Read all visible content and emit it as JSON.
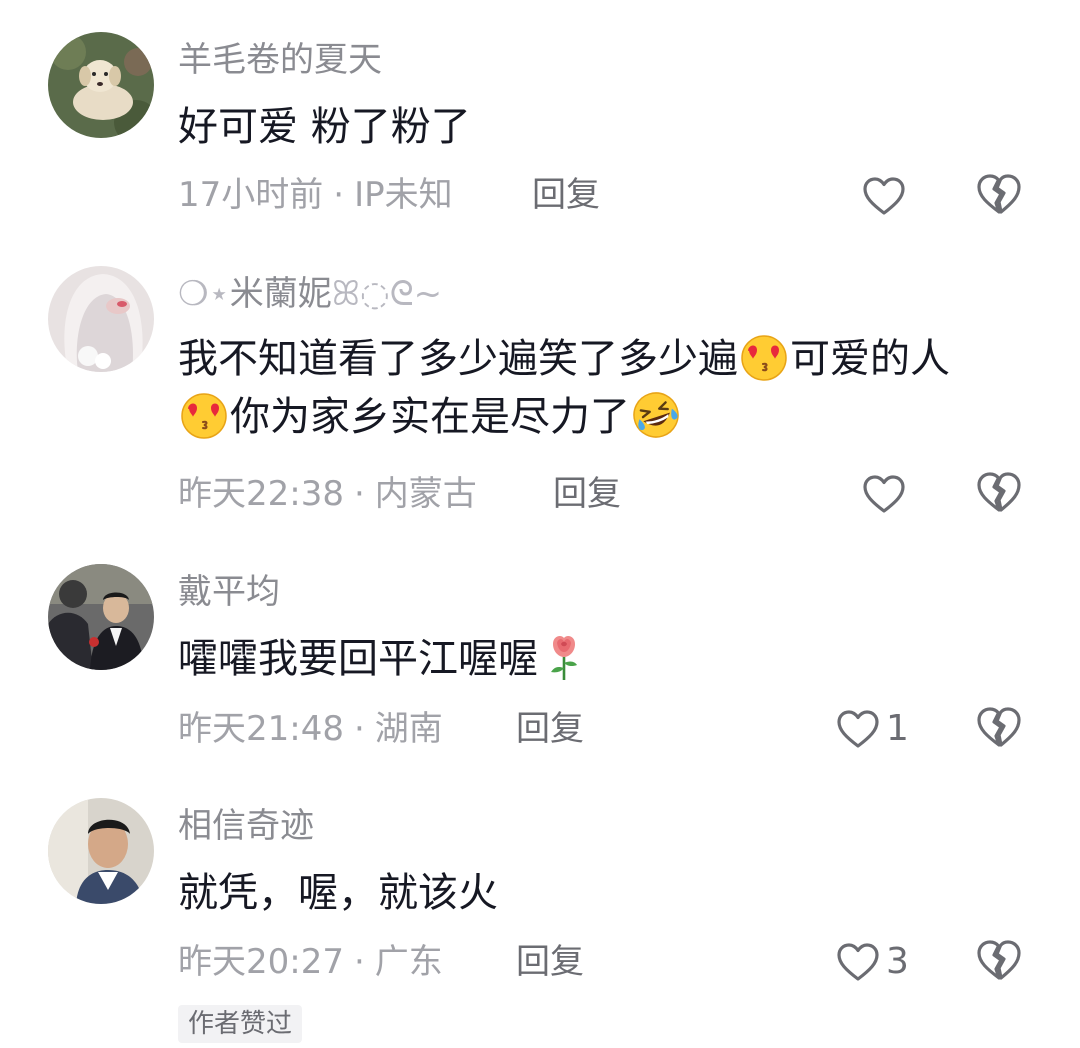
{
  "comments": [
    {
      "username": "羊毛卷的夏天",
      "text": "好可爱 粉了粉了",
      "time": "17小时前",
      "location": "IP未知",
      "reply_label": "回复",
      "likes": ""
    },
    {
      "username": "米蘭妮",
      "text_line1_a": "我不知道看了多少遍笑了多少遍",
      "text_line1_b": "可爱的人",
      "text_line2_a": "你为家乡实在是尽力了",
      "time": "昨天22:38",
      "location": "内蒙古",
      "reply_label": "回复",
      "likes": ""
    },
    {
      "username": "戴平均",
      "text": "嚯嚯我要回平江喔喔",
      "time": "昨天21:48",
      "location": "湖南",
      "reply_label": "回复",
      "likes": "1"
    },
    {
      "username": "相信奇迹",
      "text": "就凭，喔，就该火",
      "time": "昨天20:27",
      "location": "广东",
      "reply_label": "回复",
      "likes": "3",
      "badge": "作者赞过"
    }
  ],
  "separator": "·",
  "icons": {
    "like": "heart-outline-icon",
    "dislike": "broken-heart-icon",
    "emoji_kiss": "kissing-heart-eyes-emoji",
    "emoji_laugh": "rolling-laughing-emoji",
    "emoji_rose": "rose-emoji"
  },
  "colors": {
    "text": "#161823",
    "secondary": "#8a8b91",
    "meta": "#a1a2a8",
    "icon": "#6b6c72"
  }
}
